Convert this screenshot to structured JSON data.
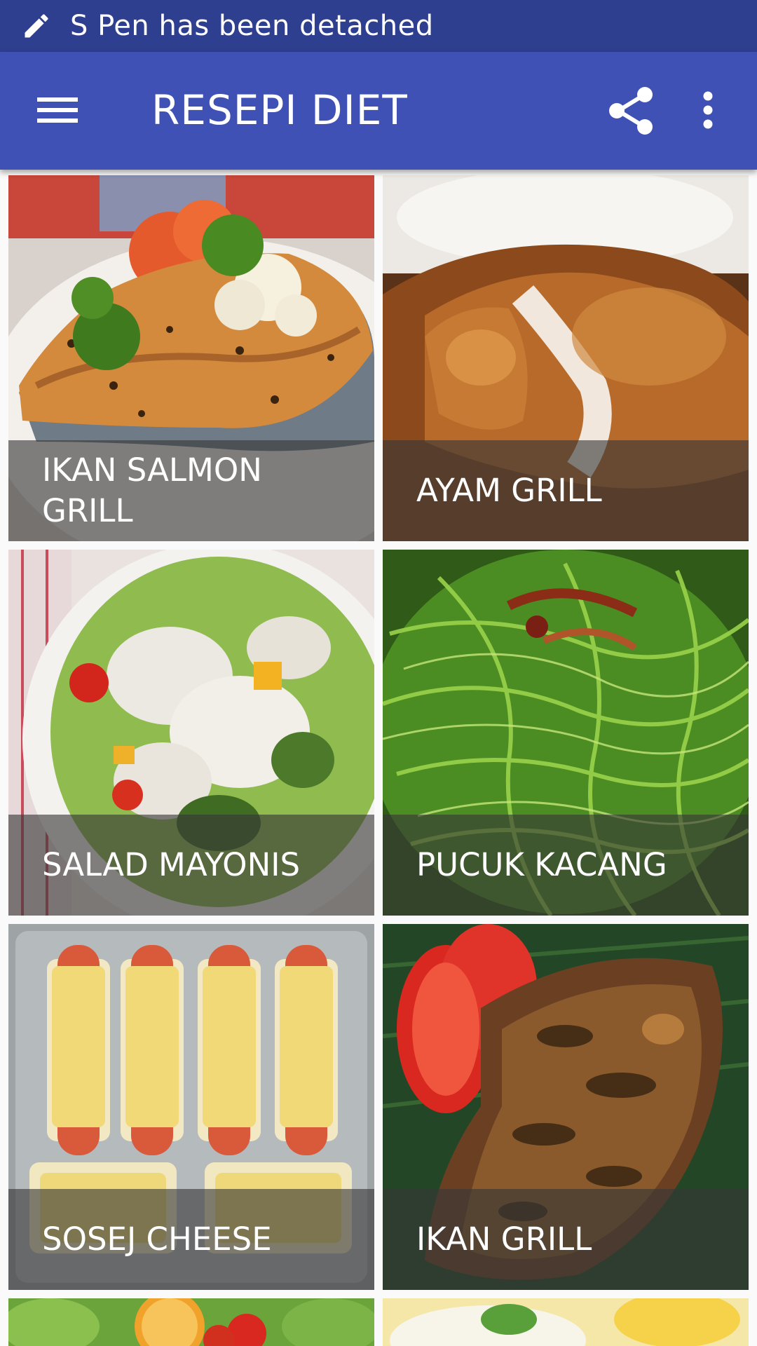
{
  "status_bar": {
    "icon": "pen-icon",
    "text": "S Pen has been detached"
  },
  "app_bar": {
    "title": "RESEPI DIET",
    "menu_icon": "hamburger-menu-icon",
    "share_icon": "share-icon",
    "overflow_icon": "more-vertical-icon"
  },
  "recipes": [
    {
      "label": "IKAN SALMON GRILL"
    },
    {
      "label": "AYAM GRILL"
    },
    {
      "label": "SALAD MAYONIS"
    },
    {
      "label": "PUCUK KACANG"
    },
    {
      "label": "SOSEJ CHEESE"
    },
    {
      "label": "IKAN GRILL"
    },
    {
      "label": ""
    },
    {
      "label": ""
    }
  ],
  "colors": {
    "status_bar": "#2f3f8f",
    "app_bar": "#3f51b5",
    "caption_overlay": "rgba(55,55,55,0.62)"
  }
}
